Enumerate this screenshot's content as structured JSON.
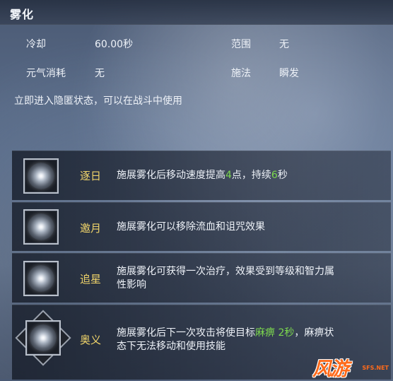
{
  "skill": {
    "title": "雾化",
    "stats": {
      "cooldown_label": "冷却",
      "cooldown_value": "60.00秒",
      "range_label": "范围",
      "range_value": "无",
      "cost_label": "元气消耗",
      "cost_value": "无",
      "cast_label": "施法",
      "cast_value": "瞬发"
    },
    "description": "立即进入隐匿状态，可以在战斗中使用"
  },
  "upgrades": [
    {
      "name": "逐日",
      "text_a": "施展雾化后移动速度提高",
      "num_1": "4",
      "text_b": "点，持续",
      "num_2": "6",
      "text_c": "秒"
    },
    {
      "name": "邀月",
      "text": "施展雾化可以移除流血和诅咒效果"
    },
    {
      "name": "追星",
      "line1": "施展雾化可获得一次治疗，效果受到等级和智力属",
      "line2": "性影响"
    },
    {
      "name": "奥义",
      "line1_a": "施展雾化后下一次攻击将使目标",
      "line1_hl": "麻痹 2秒",
      "line1_b": "，麻痹状",
      "line2": "态下无法移动和使用技能"
    }
  ],
  "watermark": {
    "big": "风游",
    "small": "SFS.NET"
  },
  "colors": {
    "upgrade_name": "#f0d46a",
    "highlight": "#7cd84e",
    "watermark": "#ff6a1a"
  },
  "icons": {
    "skill_orb": "mist-orb-icon",
    "ultimate_frame": "diamond-frame-icon"
  }
}
